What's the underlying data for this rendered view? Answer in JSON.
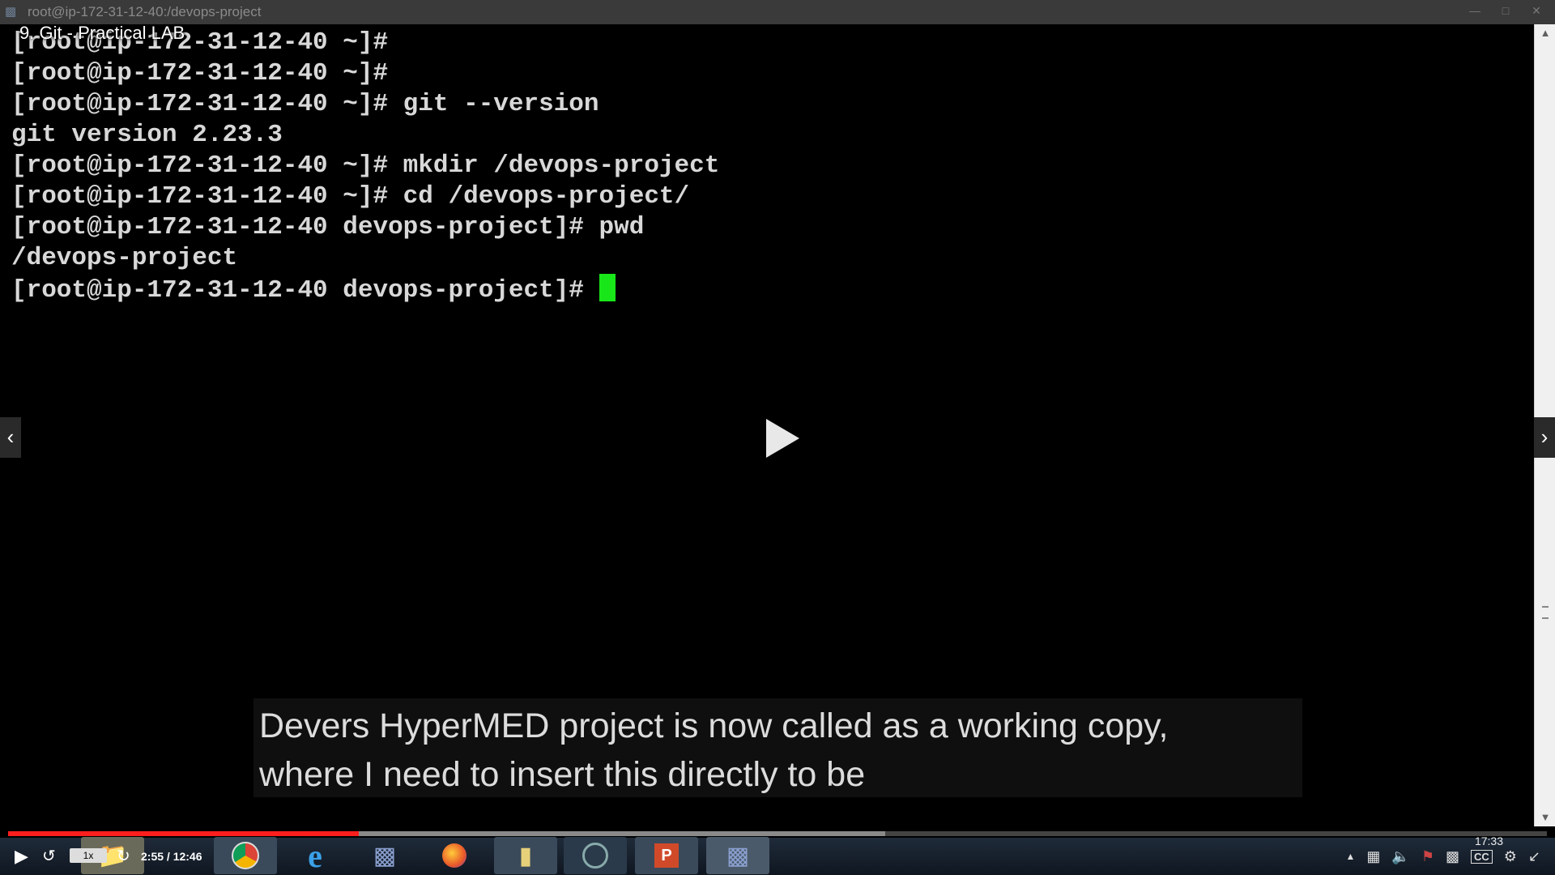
{
  "window": {
    "title": "root@ip-172-31-12-40:/devops-project"
  },
  "video": {
    "title": "9. Git - Practical LAB",
    "current_time": "2:55",
    "duration": "12:46",
    "time_display": "2:55 / 12:46",
    "speed": "1x",
    "progress_fraction": 0.228
  },
  "terminal": {
    "lines": [
      "[root@ip-172-31-12-40 ~]#",
      "[root@ip-172-31-12-40 ~]#",
      "[root@ip-172-31-12-40 ~]# git --version",
      "git version 2.23.3",
      "[root@ip-172-31-12-40 ~]# mkdir /devops-project",
      "[root@ip-172-31-12-40 ~]# cd /devops-project/",
      "[root@ip-172-31-12-40 devops-project]# pwd",
      "/devops-project"
    ],
    "prompt": "[root@ip-172-31-12-40 devops-project]# ",
    "cursor_color": "#19e619"
  },
  "caption": {
    "lines": [
      "Devers HyperMED project is now called as a working copy,",
      "where I need to insert this directly to be"
    ]
  },
  "clock": {
    "time": "17:33"
  },
  "icons": {
    "play": "play-icon",
    "replay": "replay-icon",
    "reload": "reload-icon",
    "prev": "chevron-left-icon",
    "next": "chevron-right-icon",
    "cc": "cc-icon",
    "settings": "gear-icon",
    "fullscreen": "exit-fullscreen-icon"
  },
  "colors": {
    "progress_played": "#ff1e1e",
    "terminal_bg": "#000000"
  }
}
